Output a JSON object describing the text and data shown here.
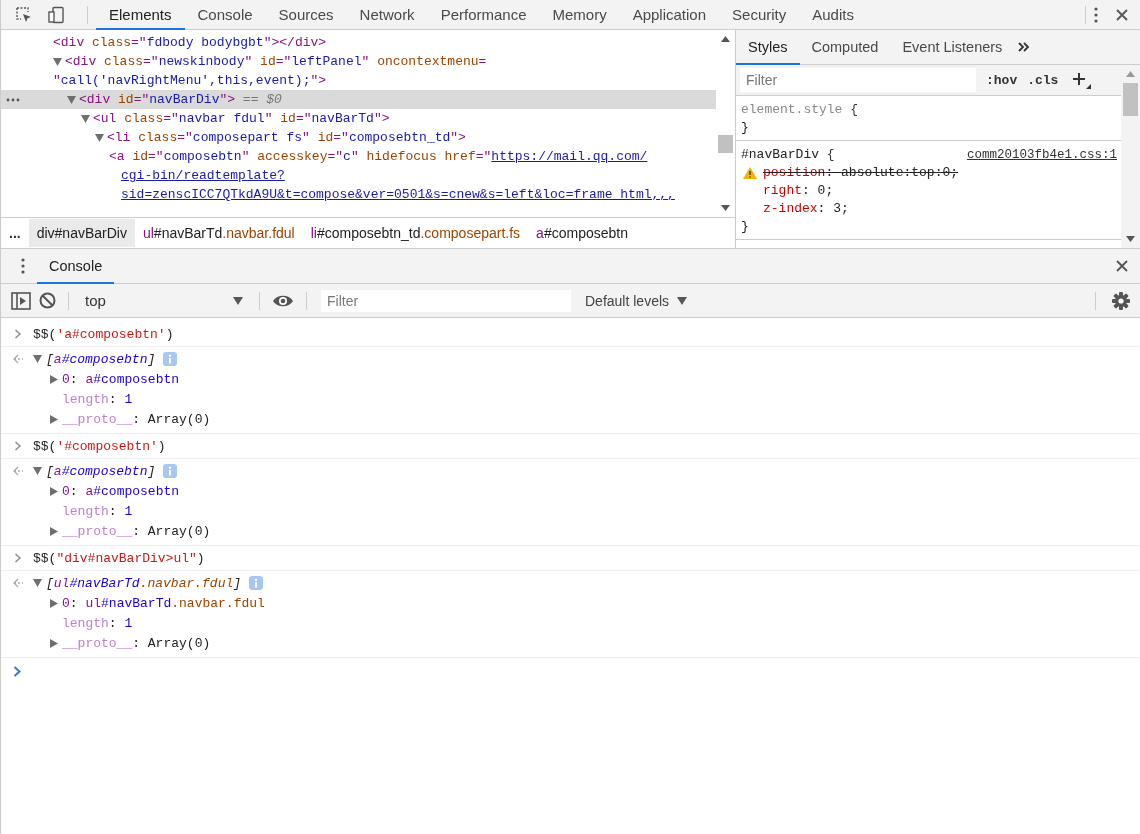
{
  "main_tabs": [
    {
      "label": "Elements",
      "selected": true
    },
    {
      "label": "Console",
      "selected": false
    },
    {
      "label": "Sources",
      "selected": false
    },
    {
      "label": "Network",
      "selected": false
    },
    {
      "label": "Performance",
      "selected": false
    },
    {
      "label": "Memory",
      "selected": false
    },
    {
      "label": "Application",
      "selected": false
    },
    {
      "label": "Security",
      "selected": false
    },
    {
      "label": "Audits",
      "selected": false
    }
  ],
  "elements": {
    "nodes": [
      {
        "selected": false,
        "lines": [
          [
            {
              "kind": "tag",
              "t": "<div "
            },
            {
              "kind": "attr",
              "t": "class"
            },
            {
              "kind": "tag",
              "t": "=\""
            },
            {
              "kind": "val",
              "t": "fdbody bodybgbt"
            },
            {
              "kind": "tag",
              "t": "\"></div>"
            }
          ]
        ]
      },
      {
        "selected": false,
        "expanded": true,
        "lines": [
          [
            {
              "kind": "tag",
              "t": "<div "
            },
            {
              "kind": "attr",
              "t": "class"
            },
            {
              "kind": "tag",
              "t": "=\""
            },
            {
              "kind": "val",
              "t": "newskinbody"
            },
            {
              "kind": "tag",
              "t": "\" "
            },
            {
              "kind": "attr",
              "t": "id"
            },
            {
              "kind": "tag",
              "t": "=\""
            },
            {
              "kind": "val",
              "t": "leftPanel"
            },
            {
              "kind": "tag",
              "t": "\" "
            },
            {
              "kind": "attr",
              "t": "oncontextmenu"
            },
            {
              "kind": "tag",
              "t": "="
            }
          ],
          [
            {
              "kind": "tag",
              "t": "\""
            },
            {
              "kind": "val",
              "t": "call('navRightMenu',this,event);"
            },
            {
              "kind": "tag",
              "t": "\">"
            }
          ]
        ],
        "children": [
          {
            "selected": true,
            "expanded": true,
            "lines": [
              [
                {
                  "kind": "tag",
                  "t": "<div "
                },
                {
                  "kind": "attr",
                  "t": "id"
                },
                {
                  "kind": "tag",
                  "t": "=\""
                },
                {
                  "kind": "val",
                  "t": "navBarDiv"
                },
                {
                  "kind": "tag",
                  "t": "\">"
                },
                {
                  "kind": "muted",
                  "t": " == $0"
                }
              ]
            ],
            "children": [
              {
                "selected": false,
                "expanded": true,
                "lines": [
                  [
                    {
                      "kind": "tag",
                      "t": "<ul "
                    },
                    {
                      "kind": "attr",
                      "t": "class"
                    },
                    {
                      "kind": "tag",
                      "t": "=\""
                    },
                    {
                      "kind": "val",
                      "t": "navbar fdul"
                    },
                    {
                      "kind": "tag",
                      "t": "\" "
                    },
                    {
                      "kind": "attr",
                      "t": "id"
                    },
                    {
                      "kind": "tag",
                      "t": "=\""
                    },
                    {
                      "kind": "val",
                      "t": "navBarTd"
                    },
                    {
                      "kind": "tag",
                      "t": "\">"
                    }
                  ]
                ],
                "children": [
                  {
                    "selected": false,
                    "expanded": true,
                    "lines": [
                      [
                        {
                          "kind": "tag",
                          "t": "<li "
                        },
                        {
                          "kind": "attr",
                          "t": "class"
                        },
                        {
                          "kind": "tag",
                          "t": "=\""
                        },
                        {
                          "kind": "val",
                          "t": "composepart fs"
                        },
                        {
                          "kind": "tag",
                          "t": "\" "
                        },
                        {
                          "kind": "attr",
                          "t": "id"
                        },
                        {
                          "kind": "tag",
                          "t": "=\""
                        },
                        {
                          "kind": "val",
                          "t": "composebtn_td"
                        },
                        {
                          "kind": "tag",
                          "t": "\">"
                        }
                      ]
                    ],
                    "children": [
                      {
                        "selected": false,
                        "lines": [
                          [
                            {
                              "kind": "tag",
                              "t": "<a "
                            },
                            {
                              "kind": "attr",
                              "t": "id"
                            },
                            {
                              "kind": "tag",
                              "t": "=\""
                            },
                            {
                              "kind": "val",
                              "t": "composebtn"
                            },
                            {
                              "kind": "tag",
                              "t": "\" "
                            },
                            {
                              "kind": "attr",
                              "t": "accesskey"
                            },
                            {
                              "kind": "tag",
                              "t": "=\""
                            },
                            {
                              "kind": "val",
                              "t": "c"
                            },
                            {
                              "kind": "tag",
                              "t": "\" "
                            },
                            {
                              "kind": "attr",
                              "t": "hidefocus href"
                            },
                            {
                              "kind": "tag",
                              "t": "=\""
                            },
                            {
                              "kind": "link",
                              "t": "https://mail.qq.com/"
                            }
                          ],
                          [
                            {
                              "kind": "link",
                              "t": "cgi-bin/readtemplate?"
                            }
                          ],
                          [
                            {
                              "kind": "link",
                              "t": "sid=zenscICC7QTkdA9U&t=compose&ver=0501&s=cnew&s=left&loc=frame_html,,,"
                            }
                          ]
                        ]
                      }
                    ]
                  }
                ]
              }
            ]
          }
        ]
      }
    ]
  },
  "breadcrumbs": {
    "more": "...",
    "items": [
      {
        "selected": true,
        "tokens": [
          {
            "kind": "plain",
            "t": "div#navBarDiv"
          }
        ]
      },
      {
        "selected": false,
        "tokens": [
          {
            "kind": "tag",
            "t": "ul"
          },
          {
            "kind": "plain",
            "t": "#navBarTd"
          },
          {
            "kind": "attr",
            "t": ".navbar.fdul"
          }
        ]
      },
      {
        "selected": false,
        "tokens": [
          {
            "kind": "tag",
            "t": "li"
          },
          {
            "kind": "plain",
            "t": "#composebtn_td"
          },
          {
            "kind": "attr",
            "t": ".composepart.fs"
          }
        ]
      },
      {
        "selected": false,
        "tokens": [
          {
            "kind": "tag",
            "t": "a"
          },
          {
            "kind": "plain",
            "t": "#composebtn"
          }
        ]
      }
    ]
  },
  "styles": {
    "tabs": [
      {
        "label": "Styles",
        "selected": true
      },
      {
        "label": "Computed",
        "selected": false
      },
      {
        "label": "Event Listeners",
        "selected": false
      }
    ],
    "filter": {
      "placeholder": "Filter"
    },
    "hov": ":hov",
    "cls": ".cls",
    "rules": [
      {
        "selector": "element.style",
        "open": " {",
        "close": "}"
      },
      {
        "selector": "#navBarDiv",
        "open": " {",
        "close": "}",
        "source": "comm20103fb4e1.css:1",
        "declarations": [
          {
            "invalid": true,
            "name": "position",
            "value": ": absolute:top:0;"
          },
          {
            "invalid": false,
            "name": "right",
            "value": ": 0;"
          },
          {
            "invalid": false,
            "name": "z-index",
            "value": ": 3;"
          }
        ]
      }
    ]
  },
  "drawer": {
    "tabs": [
      {
        "label": "Console",
        "selected": true
      }
    ],
    "context": "top",
    "filter": {
      "placeholder": "Filter"
    },
    "levels": "Default levels",
    "entries": [
      {
        "command": [
          {
            "kind": "plain",
            "t": "$$("
          },
          {
            "kind": "string",
            "t": "'a#composebtn'"
          },
          {
            "kind": "plain",
            "t": ")"
          }
        ],
        "result": {
          "expanded": true,
          "summary": [
            {
              "kind": "plain",
              "t": "["
            },
            {
              "kind": "key",
              "t": "a"
            },
            {
              "kind": "num",
              "t": "#composebtn"
            },
            {
              "kind": "plain",
              "t": "]"
            }
          ],
          "items": [
            {
              "kind": "object",
              "tokens": [
                {
                  "kind": "key",
                  "t": "0"
                },
                {
                  "kind": "plain",
                  "t": ": "
                },
                {
                  "kind": "key",
                  "t": "a"
                },
                {
                  "kind": "num",
                  "t": "#composebtn"
                }
              ]
            },
            {
              "kind": "primitive",
              "tokens": [
                {
                  "kind": "prop",
                  "t": "length"
                },
                {
                  "kind": "plain",
                  "t": ": "
                },
                {
                  "kind": "num",
                  "t": "1"
                }
              ]
            },
            {
              "kind": "object",
              "tokens": [
                {
                  "kind": "prop",
                  "t": "__proto__"
                },
                {
                  "kind": "plain",
                  "t": ": Array(0)"
                }
              ]
            }
          ]
        }
      },
      {
        "command": [
          {
            "kind": "plain",
            "t": "$$("
          },
          {
            "kind": "string",
            "t": "'#composebtn'"
          },
          {
            "kind": "plain",
            "t": ")"
          }
        ],
        "result": {
          "expanded": true,
          "summary": [
            {
              "kind": "plain",
              "t": "["
            },
            {
              "kind": "key",
              "t": "a"
            },
            {
              "kind": "num",
              "t": "#composebtn"
            },
            {
              "kind": "plain",
              "t": "]"
            }
          ],
          "items": [
            {
              "kind": "object",
              "tokens": [
                {
                  "kind": "key",
                  "t": "0"
                },
                {
                  "kind": "plain",
                  "t": ": "
                },
                {
                  "kind": "key",
                  "t": "a"
                },
                {
                  "kind": "num",
                  "t": "#composebtn"
                }
              ]
            },
            {
              "kind": "primitive",
              "tokens": [
                {
                  "kind": "prop",
                  "t": "length"
                },
                {
                  "kind": "plain",
                  "t": ": "
                },
                {
                  "kind": "num",
                  "t": "1"
                }
              ]
            },
            {
              "kind": "object",
              "tokens": [
                {
                  "kind": "prop",
                  "t": "__proto__"
                },
                {
                  "kind": "plain",
                  "t": ": Array(0)"
                }
              ]
            }
          ]
        }
      },
      {
        "command": [
          {
            "kind": "plain",
            "t": "$$("
          },
          {
            "kind": "string",
            "t": "\"div#navBarDiv>ul\""
          },
          {
            "kind": "plain",
            "t": ")"
          }
        ],
        "result": {
          "expanded": true,
          "summary": [
            {
              "kind": "plain",
              "t": "["
            },
            {
              "kind": "key",
              "t": "ul"
            },
            {
              "kind": "num",
              "t": "#navBarTd"
            },
            {
              "kind": "attr",
              "t": ".navbar.fdul"
            },
            {
              "kind": "plain",
              "t": "]"
            }
          ],
          "items": [
            {
              "kind": "object",
              "tokens": [
                {
                  "kind": "key",
                  "t": "0"
                },
                {
                  "kind": "plain",
                  "t": ": "
                },
                {
                  "kind": "key",
                  "t": "ul"
                },
                {
                  "kind": "num",
                  "t": "#navBarTd"
                },
                {
                  "kind": "attr",
                  "t": ".navbar.fdul"
                }
              ]
            },
            {
              "kind": "primitive",
              "tokens": [
                {
                  "kind": "prop",
                  "t": "length"
                },
                {
                  "kind": "plain",
                  "t": ": "
                },
                {
                  "kind": "num",
                  "t": "1"
                }
              ]
            },
            {
              "kind": "object",
              "tokens": [
                {
                  "kind": "prop",
                  "t": "__proto__"
                },
                {
                  "kind": "plain",
                  "t": ": Array(0)"
                }
              ]
            }
          ]
        }
      }
    ]
  }
}
